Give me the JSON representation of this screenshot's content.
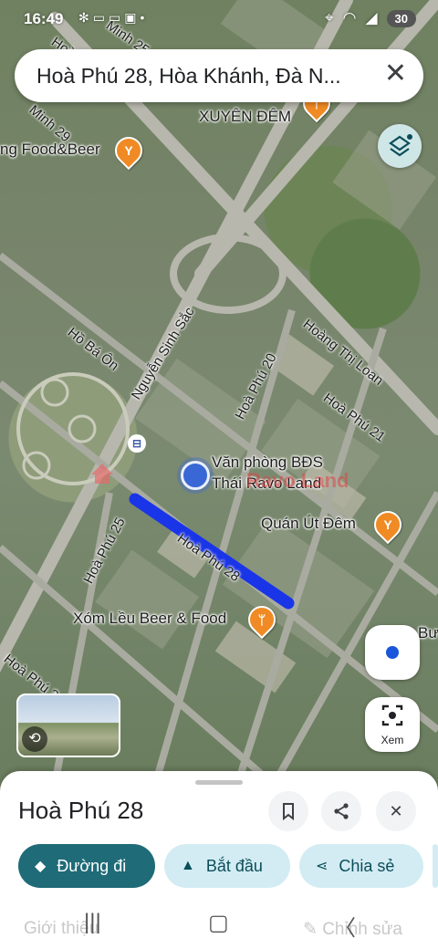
{
  "status_bar": {
    "time": "16:49",
    "notification_icons": [
      "gear-icon",
      "zalo-icon",
      "zalo-icon",
      "image-icon",
      "dot-icon"
    ],
    "battery": "30"
  },
  "search": {
    "query": "Hoà Phú 28, Hòa Khánh, Đà N..."
  },
  "map": {
    "places": {
      "xuyen_dem": "XUYÊN ĐÊM",
      "food_beer": "ng Food&Beer",
      "office_line1": "Văn phòng BĐS",
      "office_line2": "Thái Ravo Land",
      "quan_ut_dem": "Quán Út Đêm",
      "xom_leu": "Xóm Lều Beer & Food",
      "partial_right": "Bư"
    },
    "streets": {
      "minh25": "Minh 25",
      "hoa_phu_top": "Hoà",
      "minh29": "Minh 29",
      "nguyen_sinh_sac": "Nguyễn Sinh Sắc",
      "ho_ba_on": "Hồ Bá Ôn",
      "hoang_thi_loan": "Hoàng Thị Loan",
      "hoa_phu_20": "Hoà Phú 20",
      "hoa_phu_21": "Hoà Phú 21",
      "hoa_phu_25": "Hoà Phú 25",
      "hoa_phu_28": "Hoà Phú 28",
      "hoa_phu_2x": "Hoà Phú 2"
    },
    "watermark": "Ravo Land"
  },
  "controls": {
    "lens_label": "Xem"
  },
  "sheet": {
    "title": "Hoà Phú 28",
    "actions": {
      "directions": "Đường đi",
      "start": "Bắt đầu",
      "share": "Chia sẻ"
    },
    "faded_left": "Giới thiệu",
    "faded_right": "Chỉnh sửa"
  },
  "colors": {
    "primary_chip": "#1f6b78",
    "secondary_chip": "#d3ecf3",
    "route": "#1a35e8",
    "poi": "#f08a24"
  }
}
